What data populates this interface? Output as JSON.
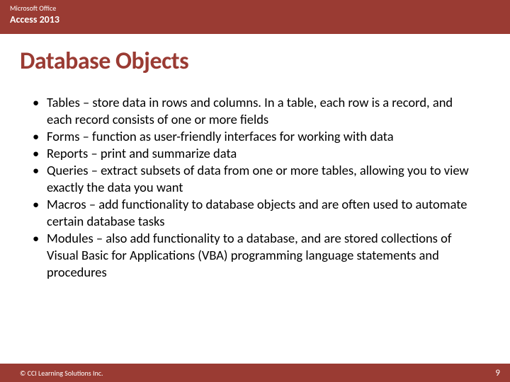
{
  "header": {
    "line1": "Microsoft Office",
    "line2": "Access 2013"
  },
  "title": "Database Objects",
  "bullets": [
    "Tables – store data in rows and columns. In a table, each row is a record, and each record consists of one or more fields",
    "Forms – function as user-friendly interfaces for working with data",
    "Reports – print and summarize data",
    "Queries – extract subsets of data from one or more tables, allowing you to view exactly the data you want",
    "Macros – add functionality to database objects and are often used to automate certain database tasks",
    "Modules – also add functionality to a database, and are stored collections of Visual Basic for Applications (VBA) programming language statements and procedures"
  ],
  "footer": {
    "copyright": "© CCI Learning Solutions Inc.",
    "page": "9"
  }
}
